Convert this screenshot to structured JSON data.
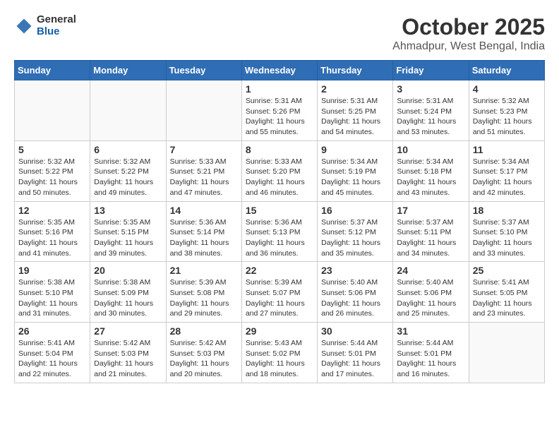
{
  "header": {
    "logo_general": "General",
    "logo_blue": "Blue",
    "month_title": "October 2025",
    "location": "Ahmadpur, West Bengal, India"
  },
  "days_of_week": [
    "Sunday",
    "Monday",
    "Tuesday",
    "Wednesday",
    "Thursday",
    "Friday",
    "Saturday"
  ],
  "weeks": [
    [
      {
        "day": "",
        "info": ""
      },
      {
        "day": "",
        "info": ""
      },
      {
        "day": "",
        "info": ""
      },
      {
        "day": "1",
        "info": "Sunrise: 5:31 AM\nSunset: 5:26 PM\nDaylight: 11 hours\nand 55 minutes."
      },
      {
        "day": "2",
        "info": "Sunrise: 5:31 AM\nSunset: 5:25 PM\nDaylight: 11 hours\nand 54 minutes."
      },
      {
        "day": "3",
        "info": "Sunrise: 5:31 AM\nSunset: 5:24 PM\nDaylight: 11 hours\nand 53 minutes."
      },
      {
        "day": "4",
        "info": "Sunrise: 5:32 AM\nSunset: 5:23 PM\nDaylight: 11 hours\nand 51 minutes."
      }
    ],
    [
      {
        "day": "5",
        "info": "Sunrise: 5:32 AM\nSunset: 5:22 PM\nDaylight: 11 hours\nand 50 minutes."
      },
      {
        "day": "6",
        "info": "Sunrise: 5:32 AM\nSunset: 5:22 PM\nDaylight: 11 hours\nand 49 minutes."
      },
      {
        "day": "7",
        "info": "Sunrise: 5:33 AM\nSunset: 5:21 PM\nDaylight: 11 hours\nand 47 minutes."
      },
      {
        "day": "8",
        "info": "Sunrise: 5:33 AM\nSunset: 5:20 PM\nDaylight: 11 hours\nand 46 minutes."
      },
      {
        "day": "9",
        "info": "Sunrise: 5:34 AM\nSunset: 5:19 PM\nDaylight: 11 hours\nand 45 minutes."
      },
      {
        "day": "10",
        "info": "Sunrise: 5:34 AM\nSunset: 5:18 PM\nDaylight: 11 hours\nand 43 minutes."
      },
      {
        "day": "11",
        "info": "Sunrise: 5:34 AM\nSunset: 5:17 PM\nDaylight: 11 hours\nand 42 minutes."
      }
    ],
    [
      {
        "day": "12",
        "info": "Sunrise: 5:35 AM\nSunset: 5:16 PM\nDaylight: 11 hours\nand 41 minutes."
      },
      {
        "day": "13",
        "info": "Sunrise: 5:35 AM\nSunset: 5:15 PM\nDaylight: 11 hours\nand 39 minutes."
      },
      {
        "day": "14",
        "info": "Sunrise: 5:36 AM\nSunset: 5:14 PM\nDaylight: 11 hours\nand 38 minutes."
      },
      {
        "day": "15",
        "info": "Sunrise: 5:36 AM\nSunset: 5:13 PM\nDaylight: 11 hours\nand 36 minutes."
      },
      {
        "day": "16",
        "info": "Sunrise: 5:37 AM\nSunset: 5:12 PM\nDaylight: 11 hours\nand 35 minutes."
      },
      {
        "day": "17",
        "info": "Sunrise: 5:37 AM\nSunset: 5:11 PM\nDaylight: 11 hours\nand 34 minutes."
      },
      {
        "day": "18",
        "info": "Sunrise: 5:37 AM\nSunset: 5:10 PM\nDaylight: 11 hours\nand 33 minutes."
      }
    ],
    [
      {
        "day": "19",
        "info": "Sunrise: 5:38 AM\nSunset: 5:10 PM\nDaylight: 11 hours\nand 31 minutes."
      },
      {
        "day": "20",
        "info": "Sunrise: 5:38 AM\nSunset: 5:09 PM\nDaylight: 11 hours\nand 30 minutes."
      },
      {
        "day": "21",
        "info": "Sunrise: 5:39 AM\nSunset: 5:08 PM\nDaylight: 11 hours\nand 29 minutes."
      },
      {
        "day": "22",
        "info": "Sunrise: 5:39 AM\nSunset: 5:07 PM\nDaylight: 11 hours\nand 27 minutes."
      },
      {
        "day": "23",
        "info": "Sunrise: 5:40 AM\nSunset: 5:06 PM\nDaylight: 11 hours\nand 26 minutes."
      },
      {
        "day": "24",
        "info": "Sunrise: 5:40 AM\nSunset: 5:06 PM\nDaylight: 11 hours\nand 25 minutes."
      },
      {
        "day": "25",
        "info": "Sunrise: 5:41 AM\nSunset: 5:05 PM\nDaylight: 11 hours\nand 23 minutes."
      }
    ],
    [
      {
        "day": "26",
        "info": "Sunrise: 5:41 AM\nSunset: 5:04 PM\nDaylight: 11 hours\nand 22 minutes."
      },
      {
        "day": "27",
        "info": "Sunrise: 5:42 AM\nSunset: 5:03 PM\nDaylight: 11 hours\nand 21 minutes."
      },
      {
        "day": "28",
        "info": "Sunrise: 5:42 AM\nSunset: 5:03 PM\nDaylight: 11 hours\nand 20 minutes."
      },
      {
        "day": "29",
        "info": "Sunrise: 5:43 AM\nSunset: 5:02 PM\nDaylight: 11 hours\nand 18 minutes."
      },
      {
        "day": "30",
        "info": "Sunrise: 5:44 AM\nSunset: 5:01 PM\nDaylight: 11 hours\nand 17 minutes."
      },
      {
        "day": "31",
        "info": "Sunrise: 5:44 AM\nSunset: 5:01 PM\nDaylight: 11 hours\nand 16 minutes."
      },
      {
        "day": "",
        "info": ""
      }
    ]
  ]
}
